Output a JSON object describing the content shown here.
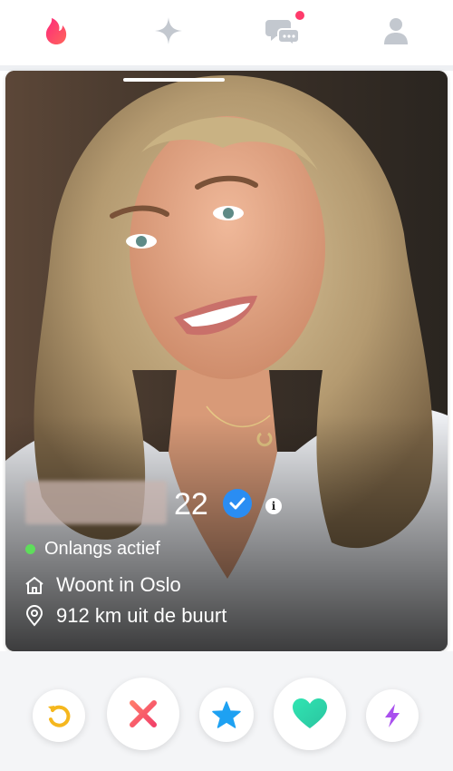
{
  "nav": {
    "items": [
      "flame-icon",
      "sparkle-icon",
      "chat-icon",
      "profile-icon"
    ],
    "active_color": "#fe3c72",
    "inactive_color": "#bfc4cb",
    "chat_has_notification": true
  },
  "card": {
    "photo_count_indicator": 1,
    "age": "22",
    "verified": true,
    "status": "Onlangs actief",
    "lives_in": "Woont in Oslo",
    "distance": "912 km uit de buurt",
    "status_color": "#5edd5b"
  },
  "actions": {
    "rewind": {
      "icon": "rewind-icon",
      "color": "#f5b71e"
    },
    "nope": {
      "icon": "close-icon",
      "color": "#f45a5a"
    },
    "super_like": {
      "icon": "star-icon",
      "color": "#1ea1f2"
    },
    "like": {
      "icon": "heart-icon",
      "color": "#2fd8a8"
    },
    "boost": {
      "icon": "bolt-icon",
      "color": "#a950ee"
    }
  }
}
